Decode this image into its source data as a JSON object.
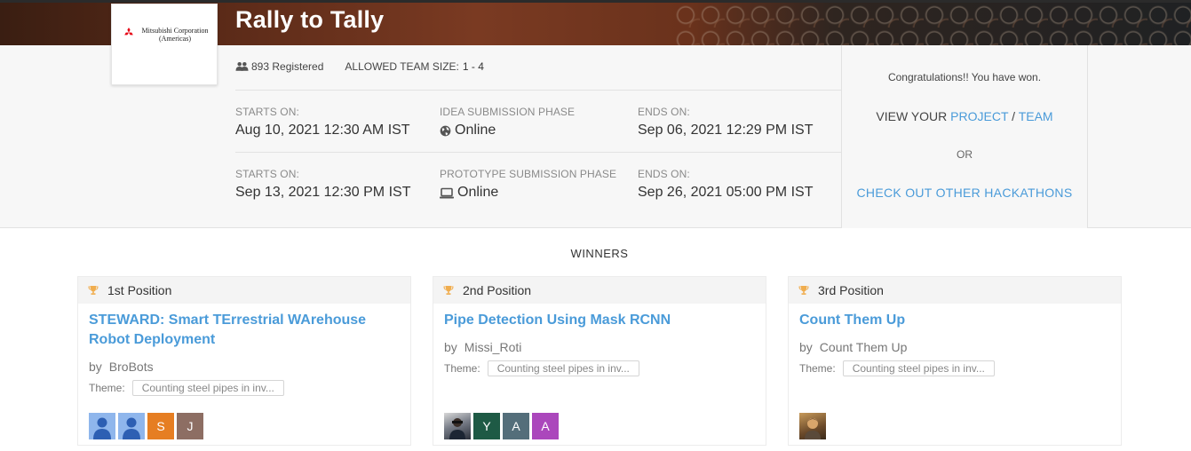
{
  "hackathon": {
    "title": "Rally to Tally",
    "logo_text": "Mitsubishi Corporation (Americas)",
    "registered": "893 Registered",
    "team_size_label": "ALLOWED TEAM SIZE:",
    "team_size_value": "1 - 4"
  },
  "phases": [
    {
      "starts_label": "STARTS ON:",
      "starts_value": "Aug 10, 2021 12:30 AM IST",
      "phase_label": "IDEA SUBMISSION PHASE",
      "phase_value": "Online",
      "phase_icon": "globe-icon",
      "ends_label": "ENDS ON:",
      "ends_value": "Sep 06, 2021 12:29 PM IST"
    },
    {
      "starts_label": "STARTS ON:",
      "starts_value": "Sep 13, 2021 12:30 PM IST",
      "phase_label": "PROTOTYPE SUBMISSION PHASE",
      "phase_value": "Online",
      "phase_icon": "laptop-icon",
      "ends_label": "ENDS ON:",
      "ends_value": "Sep 26, 2021 05:00 PM IST"
    }
  ],
  "side": {
    "congrats": "Congratulations!! You have won.",
    "view_prefix": "VIEW YOUR",
    "project_link": "PROJECT",
    "separator": "/",
    "team_link": "TEAM",
    "or_text": "OR",
    "other_hackathons": "CHECK OUT OTHER HACKATHONS"
  },
  "winners": {
    "title": "WINNERS",
    "cards": [
      {
        "position": "1st Position",
        "project": "STEWARD: Smart TErrestrial WArehouse Robot Deployment",
        "by_label": "by",
        "team": "BroBots",
        "theme_label": "Theme:",
        "theme": "Counting steel pipes in inv...",
        "avatars": [
          {
            "type": "default",
            "text": ""
          },
          {
            "type": "default",
            "text": ""
          },
          {
            "type": "letter",
            "text": "S",
            "color": "#e67e22"
          },
          {
            "type": "letter",
            "text": "J",
            "color": "#8d6e63"
          }
        ]
      },
      {
        "position": "2nd Position",
        "project": "Pipe Detection Using Mask RCNN",
        "by_label": "by",
        "team": "Missi_Roti",
        "theme_label": "Theme:",
        "theme": "Counting steel pipes in inv...",
        "avatars": [
          {
            "type": "photo1",
            "text": ""
          },
          {
            "type": "letter",
            "text": "Y",
            "color": "#1e5a45"
          },
          {
            "type": "letter",
            "text": "A",
            "color": "#546e7a"
          },
          {
            "type": "letter",
            "text": "A",
            "color": "#ab47bc"
          }
        ]
      },
      {
        "position": "3rd Position",
        "project": "Count Them Up",
        "by_label": "by",
        "team": "Count Them Up",
        "theme_label": "Theme:",
        "theme": "Counting steel pipes in inv...",
        "avatars": [
          {
            "type": "photo2",
            "text": ""
          }
        ]
      }
    ]
  },
  "colors": {
    "link": "#4a9bd9",
    "trophy": "#f0ad4e",
    "logo_red": "#e60012"
  }
}
